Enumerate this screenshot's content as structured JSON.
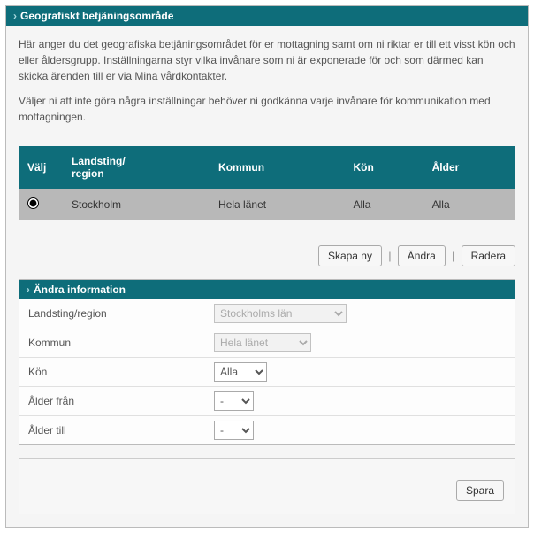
{
  "panel": {
    "title": "Geografiskt betjäningsområde",
    "intro1": "Här anger du det geografiska betjäningsområdet för er mottagning samt om ni riktar er till ett visst kön och eller åldersgrupp. Inställningarna styr vilka invånare som ni är exponerade för och som därmed kan skicka ärenden till er via Mina vårdkontakter.",
    "intro2": "Väljer ni att inte göra några inställningar behöver ni godkänna varje invånare för kommunikation med mottagningen."
  },
  "table": {
    "headers": {
      "valj": "Välj",
      "landsting1": "Landsting/",
      "landsting2": "region",
      "kommun": "Kommun",
      "kon": "Kön",
      "alder": "Ålder"
    },
    "row": {
      "landsting": "Stockholm",
      "kommun": "Hela länet",
      "kon": "Alla",
      "alder": "Alla"
    }
  },
  "buttons": {
    "skapa": "Skapa ny",
    "andra": "Ändra",
    "radera": "Radera",
    "spara": "Spara"
  },
  "form": {
    "title": "Ändra information",
    "labels": {
      "landsting": "Landsting/region",
      "kommun": "Kommun",
      "kon": "Kön",
      "alderfran": "Ålder från",
      "aldertill": "Ålder till"
    },
    "values": {
      "landsting": "Stockholms län",
      "kommun": "Hela länet",
      "kon": "Alla",
      "alderfran": "-",
      "aldertill": "-"
    }
  }
}
